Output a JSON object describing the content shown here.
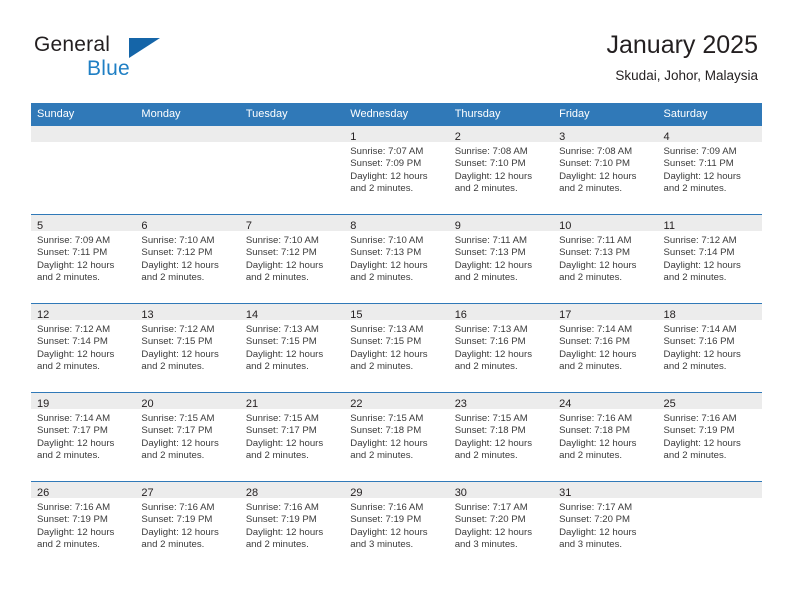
{
  "brand": {
    "name_part1": "General",
    "name_part2": "Blue",
    "flag_icon": "triangle-flag-icon"
  },
  "header": {
    "title": "January 2025",
    "location": "Skudai, Johor, Malaysia"
  },
  "colors": {
    "header_blue": "#3079b8",
    "brand_blue": "#1f7fc4",
    "daynum_band": "#ececec",
    "text": "#231f20"
  },
  "weekday_headers": [
    "Sunday",
    "Monday",
    "Tuesday",
    "Wednesday",
    "Thursday",
    "Friday",
    "Saturday"
  ],
  "weeks": [
    [
      {
        "day": "",
        "lines": []
      },
      {
        "day": "",
        "lines": []
      },
      {
        "day": "",
        "lines": []
      },
      {
        "day": "1",
        "lines": [
          "Sunrise: 7:07 AM",
          "Sunset: 7:09 PM",
          "Daylight: 12 hours",
          "and 2 minutes."
        ]
      },
      {
        "day": "2",
        "lines": [
          "Sunrise: 7:08 AM",
          "Sunset: 7:10 PM",
          "Daylight: 12 hours",
          "and 2 minutes."
        ]
      },
      {
        "day": "3",
        "lines": [
          "Sunrise: 7:08 AM",
          "Sunset: 7:10 PM",
          "Daylight: 12 hours",
          "and 2 minutes."
        ]
      },
      {
        "day": "4",
        "lines": [
          "Sunrise: 7:09 AM",
          "Sunset: 7:11 PM",
          "Daylight: 12 hours",
          "and 2 minutes."
        ]
      }
    ],
    [
      {
        "day": "5",
        "lines": [
          "Sunrise: 7:09 AM",
          "Sunset: 7:11 PM",
          "Daylight: 12 hours",
          "and 2 minutes."
        ]
      },
      {
        "day": "6",
        "lines": [
          "Sunrise: 7:10 AM",
          "Sunset: 7:12 PM",
          "Daylight: 12 hours",
          "and 2 minutes."
        ]
      },
      {
        "day": "7",
        "lines": [
          "Sunrise: 7:10 AM",
          "Sunset: 7:12 PM",
          "Daylight: 12 hours",
          "and 2 minutes."
        ]
      },
      {
        "day": "8",
        "lines": [
          "Sunrise: 7:10 AM",
          "Sunset: 7:13 PM",
          "Daylight: 12 hours",
          "and 2 minutes."
        ]
      },
      {
        "day": "9",
        "lines": [
          "Sunrise: 7:11 AM",
          "Sunset: 7:13 PM",
          "Daylight: 12 hours",
          "and 2 minutes."
        ]
      },
      {
        "day": "10",
        "lines": [
          "Sunrise: 7:11 AM",
          "Sunset: 7:13 PM",
          "Daylight: 12 hours",
          "and 2 minutes."
        ]
      },
      {
        "day": "11",
        "lines": [
          "Sunrise: 7:12 AM",
          "Sunset: 7:14 PM",
          "Daylight: 12 hours",
          "and 2 minutes."
        ]
      }
    ],
    [
      {
        "day": "12",
        "lines": [
          "Sunrise: 7:12 AM",
          "Sunset: 7:14 PM",
          "Daylight: 12 hours",
          "and 2 minutes."
        ]
      },
      {
        "day": "13",
        "lines": [
          "Sunrise: 7:12 AM",
          "Sunset: 7:15 PM",
          "Daylight: 12 hours",
          "and 2 minutes."
        ]
      },
      {
        "day": "14",
        "lines": [
          "Sunrise: 7:13 AM",
          "Sunset: 7:15 PM",
          "Daylight: 12 hours",
          "and 2 minutes."
        ]
      },
      {
        "day": "15",
        "lines": [
          "Sunrise: 7:13 AM",
          "Sunset: 7:15 PM",
          "Daylight: 12 hours",
          "and 2 minutes."
        ]
      },
      {
        "day": "16",
        "lines": [
          "Sunrise: 7:13 AM",
          "Sunset: 7:16 PM",
          "Daylight: 12 hours",
          "and 2 minutes."
        ]
      },
      {
        "day": "17",
        "lines": [
          "Sunrise: 7:14 AM",
          "Sunset: 7:16 PM",
          "Daylight: 12 hours",
          "and 2 minutes."
        ]
      },
      {
        "day": "18",
        "lines": [
          "Sunrise: 7:14 AM",
          "Sunset: 7:16 PM",
          "Daylight: 12 hours",
          "and 2 minutes."
        ]
      }
    ],
    [
      {
        "day": "19",
        "lines": [
          "Sunrise: 7:14 AM",
          "Sunset: 7:17 PM",
          "Daylight: 12 hours",
          "and 2 minutes."
        ]
      },
      {
        "day": "20",
        "lines": [
          "Sunrise: 7:15 AM",
          "Sunset: 7:17 PM",
          "Daylight: 12 hours",
          "and 2 minutes."
        ]
      },
      {
        "day": "21",
        "lines": [
          "Sunrise: 7:15 AM",
          "Sunset: 7:17 PM",
          "Daylight: 12 hours",
          "and 2 minutes."
        ]
      },
      {
        "day": "22",
        "lines": [
          "Sunrise: 7:15 AM",
          "Sunset: 7:18 PM",
          "Daylight: 12 hours",
          "and 2 minutes."
        ]
      },
      {
        "day": "23",
        "lines": [
          "Sunrise: 7:15 AM",
          "Sunset: 7:18 PM",
          "Daylight: 12 hours",
          "and 2 minutes."
        ]
      },
      {
        "day": "24",
        "lines": [
          "Sunrise: 7:16 AM",
          "Sunset: 7:18 PM",
          "Daylight: 12 hours",
          "and 2 minutes."
        ]
      },
      {
        "day": "25",
        "lines": [
          "Sunrise: 7:16 AM",
          "Sunset: 7:19 PM",
          "Daylight: 12 hours",
          "and 2 minutes."
        ]
      }
    ],
    [
      {
        "day": "26",
        "lines": [
          "Sunrise: 7:16 AM",
          "Sunset: 7:19 PM",
          "Daylight: 12 hours",
          "and 2 minutes."
        ]
      },
      {
        "day": "27",
        "lines": [
          "Sunrise: 7:16 AM",
          "Sunset: 7:19 PM",
          "Daylight: 12 hours",
          "and 2 minutes."
        ]
      },
      {
        "day": "28",
        "lines": [
          "Sunrise: 7:16 AM",
          "Sunset: 7:19 PM",
          "Daylight: 12 hours",
          "and 2 minutes."
        ]
      },
      {
        "day": "29",
        "lines": [
          "Sunrise: 7:16 AM",
          "Sunset: 7:19 PM",
          "Daylight: 12 hours",
          "and 3 minutes."
        ]
      },
      {
        "day": "30",
        "lines": [
          "Sunrise: 7:17 AM",
          "Sunset: 7:20 PM",
          "Daylight: 12 hours",
          "and 3 minutes."
        ]
      },
      {
        "day": "31",
        "lines": [
          "Sunrise: 7:17 AM",
          "Sunset: 7:20 PM",
          "Daylight: 12 hours",
          "and 3 minutes."
        ]
      },
      {
        "day": "",
        "lines": []
      }
    ]
  ]
}
